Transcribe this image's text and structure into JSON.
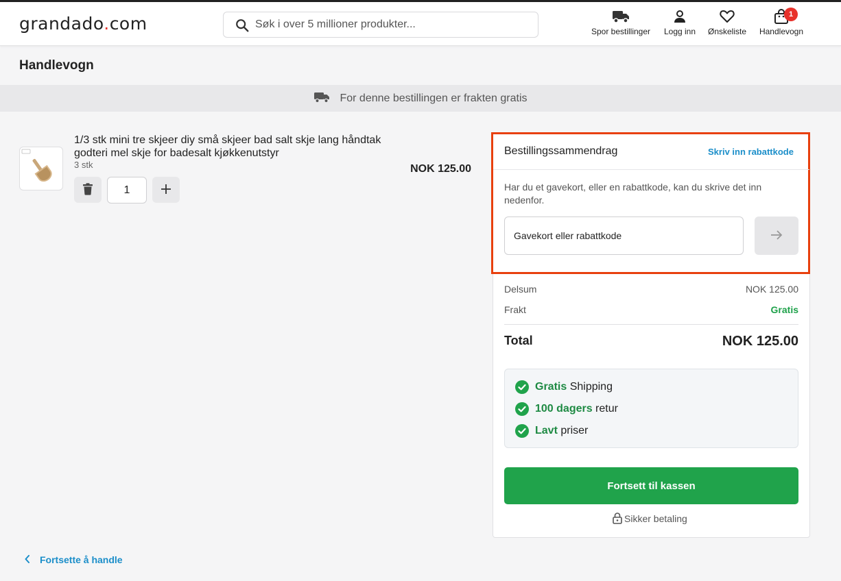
{
  "header": {
    "logo_text": "grandado",
    "logo_dot": ".",
    "logo_suffix": "com",
    "search_placeholder": "Søk i over 5 millioner produkter...",
    "nav": {
      "track": "Spor bestillinger",
      "login": "Logg inn",
      "wishlist": "Ønskeliste",
      "cart": "Handlevogn",
      "cart_count": "1"
    }
  },
  "page": {
    "title": "Handlevogn",
    "shipping_banner": "For denne bestillingen er frakten gratis"
  },
  "cart_item": {
    "title": "1/3 stk mini tre skjeer diy små skjeer bad salt skje lang håndtak godteri mel skje for badesalt kjøkkenutstyr",
    "variant": "3 stk",
    "quantity": "1",
    "price": "NOK 125.00"
  },
  "summary": {
    "title": "Bestillingssammendrag",
    "promo_link": "Skriv inn rabattkode",
    "promo_hint": "Har du et gavekort, eller en rabattkode, kan du skrive det inn nedenfor.",
    "code_placeholder": "Gavekort eller rabattkode",
    "subtotal_label": "Delsum",
    "subtotal_value": "NOK 125.00",
    "shipping_label": "Frakt",
    "shipping_value": "Gratis",
    "total_label": "Total",
    "total_value": "NOK 125.00",
    "benefits": [
      {
        "bold": "Gratis",
        "rest": " Shipping"
      },
      {
        "bold": "100 dagers",
        "rest": " retur"
      },
      {
        "bold": "Lavt",
        "rest": " priser"
      }
    ],
    "checkout_label": "Fortsett til kassen",
    "secure_label": "Sikker betaling"
  },
  "footer": {
    "continue_label": "Fortsette å handle"
  },
  "colors": {
    "accent_green": "#20a34b",
    "link_blue": "#1b8ec9",
    "badge_red": "#e8322b",
    "highlight_orange": "#e8400e"
  }
}
